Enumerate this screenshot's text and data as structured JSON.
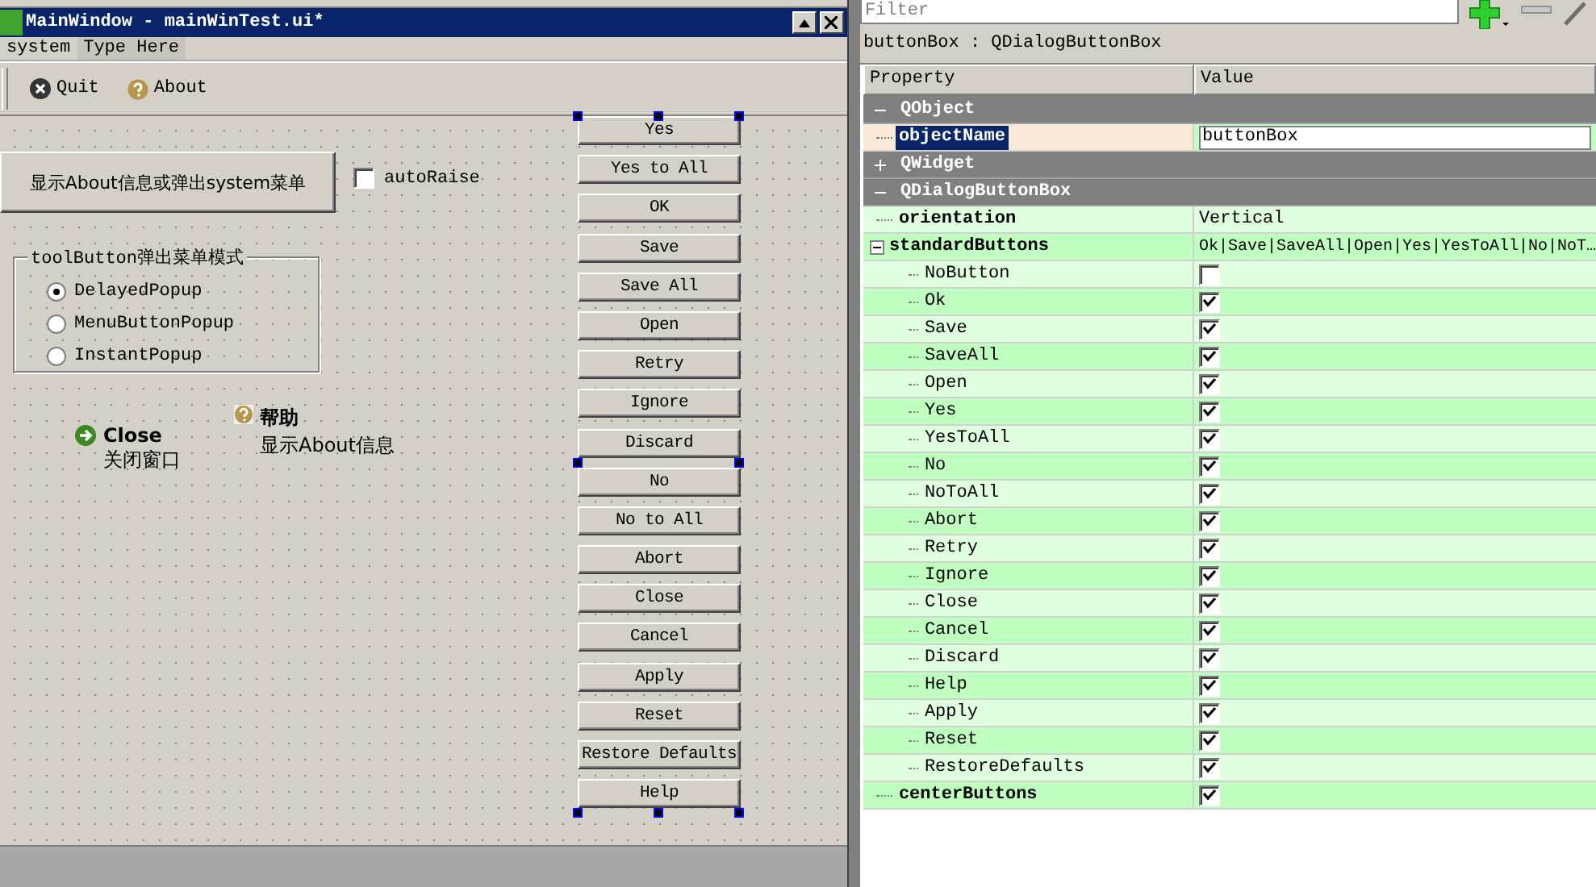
{
  "window": {
    "title": "MainWindow - mainWinTest.ui*"
  },
  "menu": [
    {
      "label": "system",
      "kind": "menu"
    },
    {
      "label": "Type Here",
      "kind": "placeholder"
    }
  ],
  "toolbar": [
    {
      "label": "Quit",
      "kind": "quit"
    },
    {
      "label": "About",
      "kind": "about"
    }
  ],
  "tool_button": {
    "label": "显示About信息或弹出system菜单"
  },
  "auto_raise": {
    "label": "autoRaise",
    "checked": false
  },
  "popup_mode": {
    "title": "toolButton弹出菜单模式",
    "options": [
      {
        "label": "DelayedPopup",
        "selected": true
      },
      {
        "label": "MenuButtonPopup",
        "selected": false
      },
      {
        "label": "InstantPopup",
        "selected": false
      }
    ]
  },
  "command_links": [
    {
      "kind": "help",
      "title": "帮助",
      "description": "显示About信息"
    },
    {
      "kind": "close",
      "title": "Close",
      "description": "关闭窗口"
    }
  ],
  "button_box": {
    "selected": true,
    "buttons": [
      "Yes",
      "Yes to All",
      "OK",
      "Save",
      "Save All",
      "Open",
      "Retry",
      "Ignore",
      "Discard",
      "No",
      "No to All",
      "Abort",
      "Close",
      "Cancel",
      "Apply",
      "Reset",
      "Restore Defaults",
      "Help"
    ]
  },
  "property_editor": {
    "filter": {
      "placeholder": "Filter"
    },
    "object_label": "buttonBox : QDialogButtonBox",
    "columns": [
      "Property",
      "Value"
    ],
    "groups": [
      {
        "name": "QObject",
        "expanded": true,
        "properties": [
          {
            "name": "objectName",
            "kind": "text",
            "value": "buttonBox",
            "selected": true
          }
        ]
      },
      {
        "name": "QWidget",
        "expanded": false
      },
      {
        "name": "QDialogButtonBox",
        "expanded": true,
        "properties": [
          {
            "name": "orientation",
            "kind": "text",
            "value": "Vertical",
            "selected": false
          },
          {
            "name": "standardButtons",
            "kind": "flags",
            "value": "Ok|Save|SaveAll|Open|Yes|YesToAll|No|NoT…",
            "selected": false,
            "expanded": true,
            "children": [
              {
                "name": "NoButton",
                "checked": false,
                "selected": false
              },
              {
                "name": "Ok",
                "checked": true,
                "selected": false
              },
              {
                "name": "Save",
                "checked": true,
                "selected": false
              },
              {
                "name": "SaveAll",
                "checked": true,
                "selected": false
              },
              {
                "name": "Open",
                "checked": true,
                "selected": false
              },
              {
                "name": "Yes",
                "checked": true,
                "selected": false
              },
              {
                "name": "YesToAll",
                "checked": true,
                "selected": false
              },
              {
                "name": "No",
                "checked": true,
                "selected": false
              },
              {
                "name": "NoToAll",
                "checked": true,
                "selected": false
              },
              {
                "name": "Abort",
                "checked": true,
                "selected": false
              },
              {
                "name": "Retry",
                "checked": true,
                "selected": false
              },
              {
                "name": "Ignore",
                "checked": true,
                "selected": false
              },
              {
                "name": "Close",
                "checked": true,
                "selected": false
              },
              {
                "name": "Cancel",
                "checked": true,
                "selected": false
              },
              {
                "name": "Discard",
                "checked": true,
                "selected": false
              },
              {
                "name": "Help",
                "checked": true,
                "selected": false
              },
              {
                "name": "Apply",
                "checked": true,
                "selected": false
              },
              {
                "name": "Reset",
                "checked": true,
                "selected": false
              },
              {
                "name": "RestoreDefaults",
                "checked": true,
                "selected": false
              }
            ]
          },
          {
            "name": "centerButtons",
            "kind": "bool",
            "checked": true,
            "selected": false
          }
        ]
      }
    ]
  }
}
